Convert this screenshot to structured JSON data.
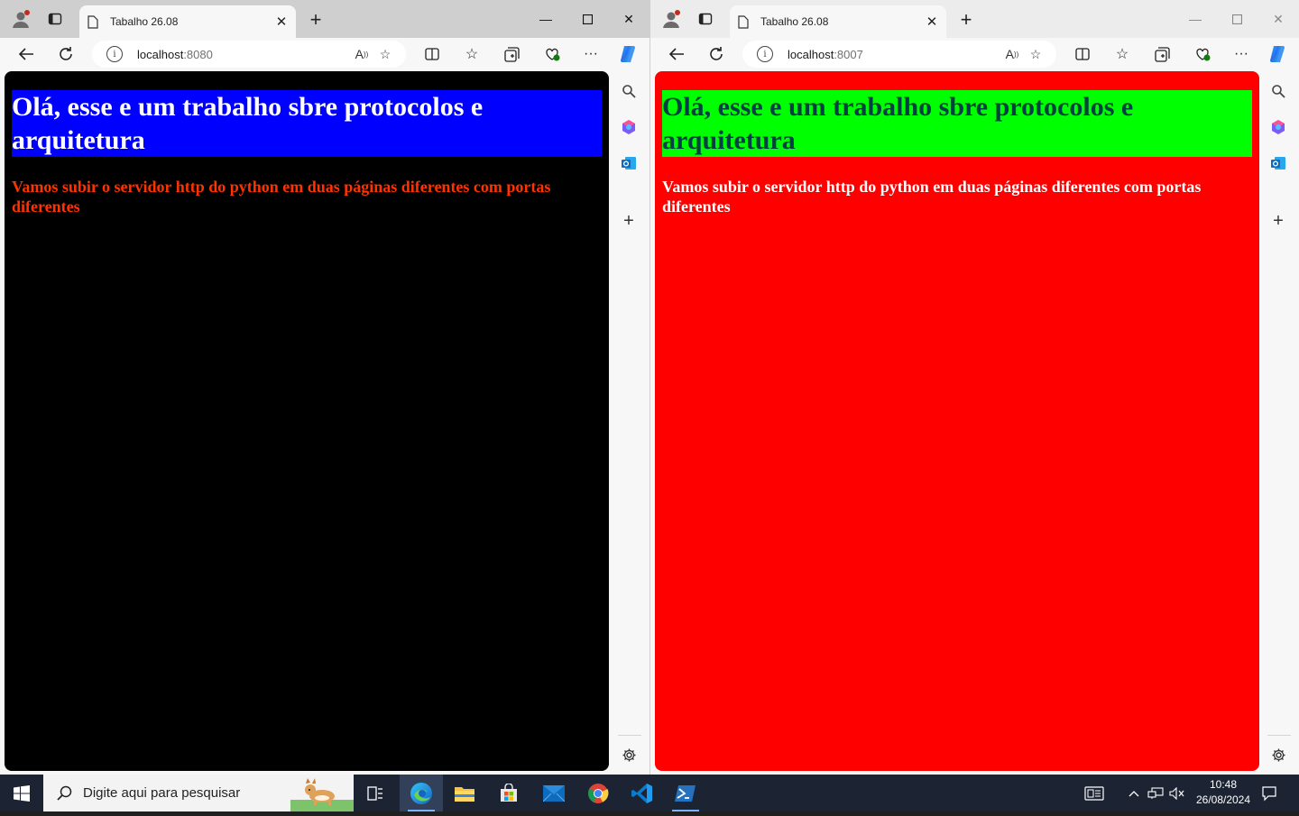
{
  "browsers": [
    {
      "tab_title": "Tabalho 26.08",
      "url_host": "localhost",
      "url_port": ":8080",
      "page": {
        "heading": "Olá, esse e um trabalho sbre protocolos e arquitetura",
        "paragraph": "Vamos subir o servidor http do python em duas páginas diferentes com portas diferentes",
        "body_bg": "#000000",
        "heading_bg": "#0000ff",
        "heading_color": "#ffffff",
        "paragraph_color": "#ff3300"
      }
    },
    {
      "tab_title": "Tabalho 26.08",
      "url_host": "localhost",
      "url_port": ":8007",
      "page": {
        "heading": "Olá, esse e um trabalho sbre protocolos e arquitetura",
        "paragraph": "Vamos subir o servidor http do python em duas páginas diferentes com portas diferentes",
        "body_bg": "#ff0000",
        "heading_bg": "#00ff00",
        "heading_color": "#004040",
        "paragraph_color": "#ffffff"
      }
    }
  ],
  "taskbar": {
    "search_placeholder": "Digite aqui para pesquisar",
    "time": "10:48",
    "date": "26/08/2024",
    "apps": [
      "task-view",
      "edge",
      "file-explorer",
      "microsoft-store",
      "mail",
      "chrome",
      "vscode",
      "powershell"
    ]
  },
  "colors": {
    "taskbar_bg": "#1c2434",
    "accent": "#0078d4"
  }
}
